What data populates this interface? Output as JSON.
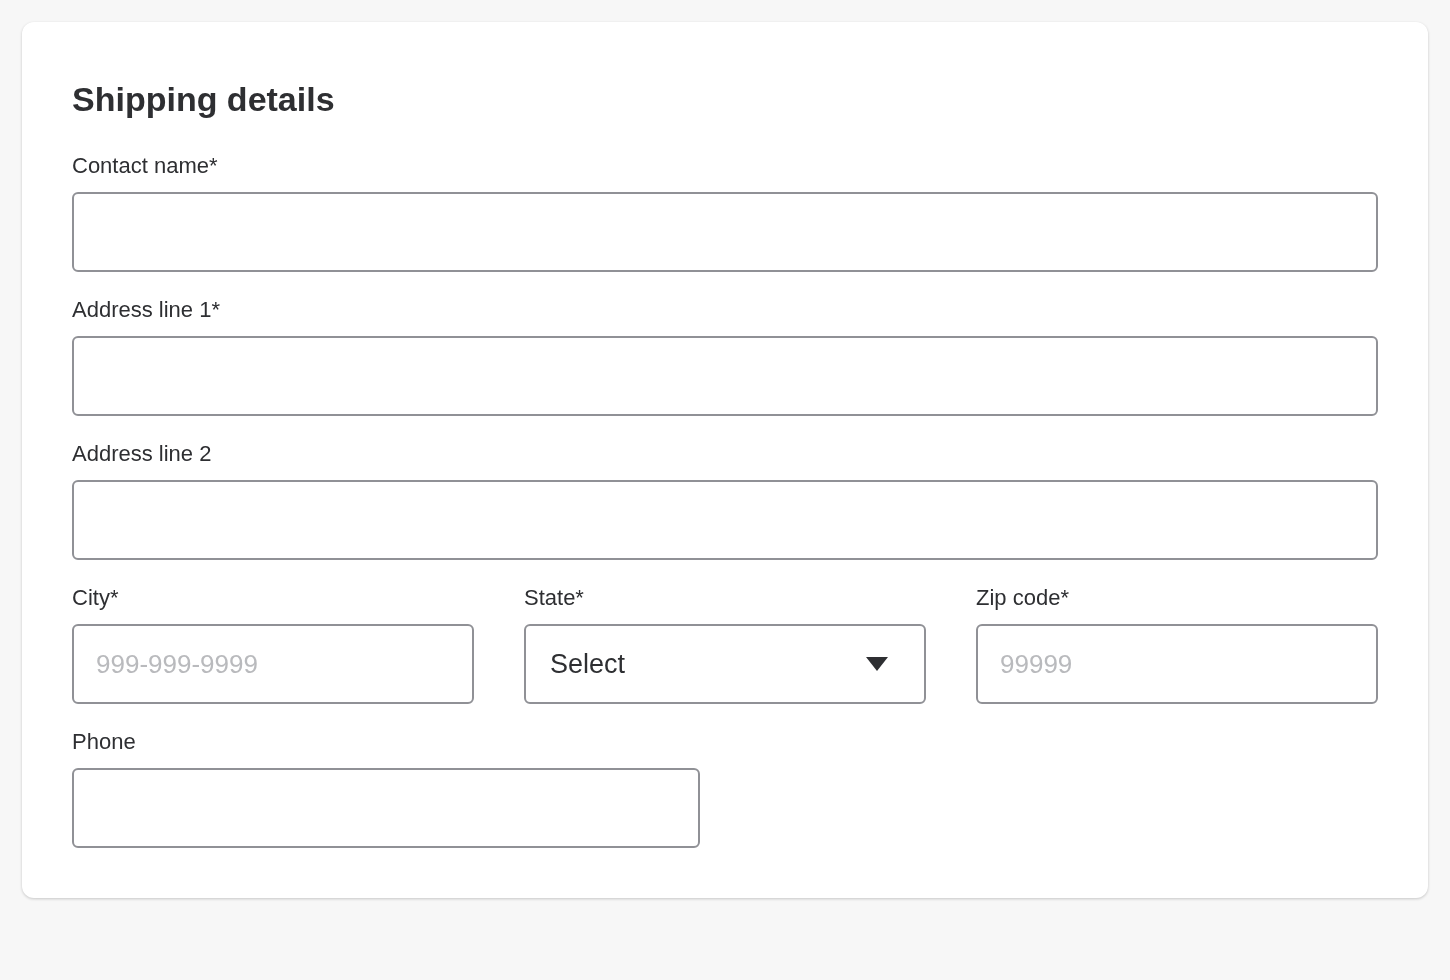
{
  "card": {
    "title": "Shipping details",
    "rows": [
      {
        "kind": "full",
        "fields": [
          {
            "kind": "text",
            "label": "Contact name*"
          }
        ]
      },
      {
        "kind": "full",
        "fields": [
          {
            "kind": "text",
            "label": "Address line 1*"
          }
        ]
      },
      {
        "kind": "full",
        "fields": [
          {
            "kind": "text",
            "label": "Address line 2"
          }
        ]
      },
      {
        "kind": "triple",
        "fields": [
          {
            "kind": "text",
            "label": "City*",
            "placeholder": "999-999-9999"
          },
          {
            "kind": "select",
            "label": "State*",
            "value": "Select"
          },
          {
            "kind": "text",
            "label": "Zip code*",
            "placeholder": "99999"
          }
        ]
      },
      {
        "kind": "half",
        "fields": [
          {
            "kind": "text",
            "label": "Phone"
          }
        ]
      }
    ]
  }
}
